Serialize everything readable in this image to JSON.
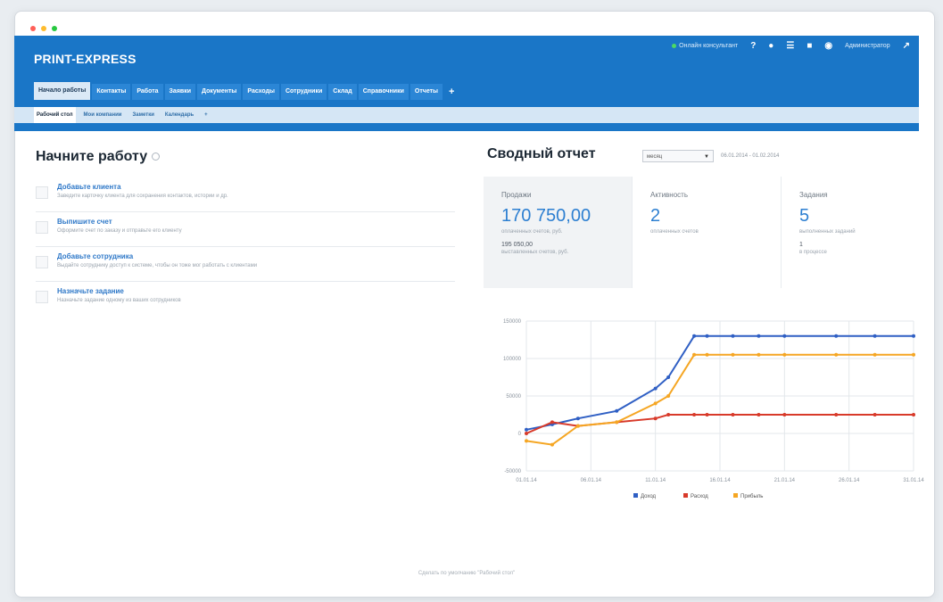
{
  "app": {
    "brand": "PRINT-EXPRESS",
    "online": "Онлайн консультант",
    "admin": "Администратор",
    "icon_names": [
      "question-icon",
      "user-icon",
      "list-icon",
      "pages-icon",
      "help-icon",
      "logout-icon"
    ]
  },
  "tabs": [
    {
      "label": "Начало работы",
      "active": true
    },
    {
      "label": "Контакты",
      "active": false
    },
    {
      "label": "Работа",
      "active": false
    },
    {
      "label": "Заявки",
      "active": false
    },
    {
      "label": "Документы",
      "active": false
    },
    {
      "label": "Расходы",
      "active": false
    },
    {
      "label": "Сотрудники",
      "active": false
    },
    {
      "label": "Склад",
      "active": false
    },
    {
      "label": "Справочники",
      "active": false
    },
    {
      "label": "Отчеты",
      "active": false
    }
  ],
  "subtabs": [
    {
      "label": "Рабочий стол",
      "active": true
    },
    {
      "label": "Мои компании",
      "active": false
    },
    {
      "label": "Заметки",
      "active": false
    },
    {
      "label": "Календарь",
      "active": false
    }
  ],
  "left": {
    "title": "Начните работу",
    "tasks": [
      {
        "title": "Добавьте клиента",
        "desc": "Заведите карточку клиента для сохранения контактов, истории и др."
      },
      {
        "title": "Выпишите счет",
        "desc": "Оформите счет по заказу и отправьте его клиенту"
      },
      {
        "title": "Добавьте сотрудника",
        "desc": "Выдайте сотруднику доступ к системе, чтобы он тоже мог работать с клиентами"
      },
      {
        "title": "Назначьте задание",
        "desc": "Назначьте задание одному из ваших сотрудников"
      }
    ]
  },
  "report": {
    "title": "Сводный отчет",
    "period": "месяц",
    "date_range": "06.01.2014 - 01.02.2014",
    "stats": [
      {
        "label": "Продажи",
        "value": "170 750,00",
        "sub": "оплаченных счетов, руб.",
        "value2": "195 050,00",
        "sub2": "выставленных счетов, руб."
      },
      {
        "label": "Активность",
        "value": "2",
        "sub": "оплаченных счетов",
        "value2": "",
        "sub2": ""
      },
      {
        "label": "Задания",
        "value": "5",
        "sub": "выполненных заданий",
        "value2": "1",
        "sub2": "в процессе"
      }
    ]
  },
  "footer": "Сделать по умолчанию \"Рабочий стол\"",
  "colors": {
    "brand": "#1a76c7",
    "income": "#2f5fc4",
    "expense": "#d83a2a",
    "profit": "#f5a623"
  },
  "chart_data": {
    "type": "line",
    "x": [
      "01.01.14",
      "03.01.14",
      "05.01.14",
      "08.01.14",
      "11.01.14",
      "12.01.14",
      "14.01.14",
      "15.01.14",
      "17.01.14",
      "19.01.14",
      "21.01.14",
      "25.01.14",
      "28.01.14",
      "31.01.14"
    ],
    "x_ticks": [
      "01.01.14",
      "06.01.14",
      "11.01.14",
      "16.01.14",
      "21.01.14",
      "26.01.14",
      "31.01.14"
    ],
    "yticks": [
      "-50000",
      "0",
      "50000",
      "100000",
      "150000"
    ],
    "ylim": [
      -50000,
      150000
    ],
    "series": [
      {
        "name": "Доход",
        "values": [
          5000,
          12000,
          20000,
          30000,
          60000,
          75000,
          130000,
          130000,
          130000,
          130000,
          130000,
          130000,
          130000,
          130000
        ]
      },
      {
        "name": "Расход",
        "values": [
          0,
          15000,
          10000,
          15000,
          20000,
          25000,
          25000,
          25000,
          25000,
          25000,
          25000,
          25000,
          25000,
          25000
        ]
      },
      {
        "name": "Прибыль",
        "values": [
          -10000,
          -15000,
          10000,
          15000,
          40000,
          50000,
          105000,
          105000,
          105000,
          105000,
          105000,
          105000,
          105000,
          105000
        ]
      }
    ],
    "grid": true,
    "legend": "bottom"
  }
}
